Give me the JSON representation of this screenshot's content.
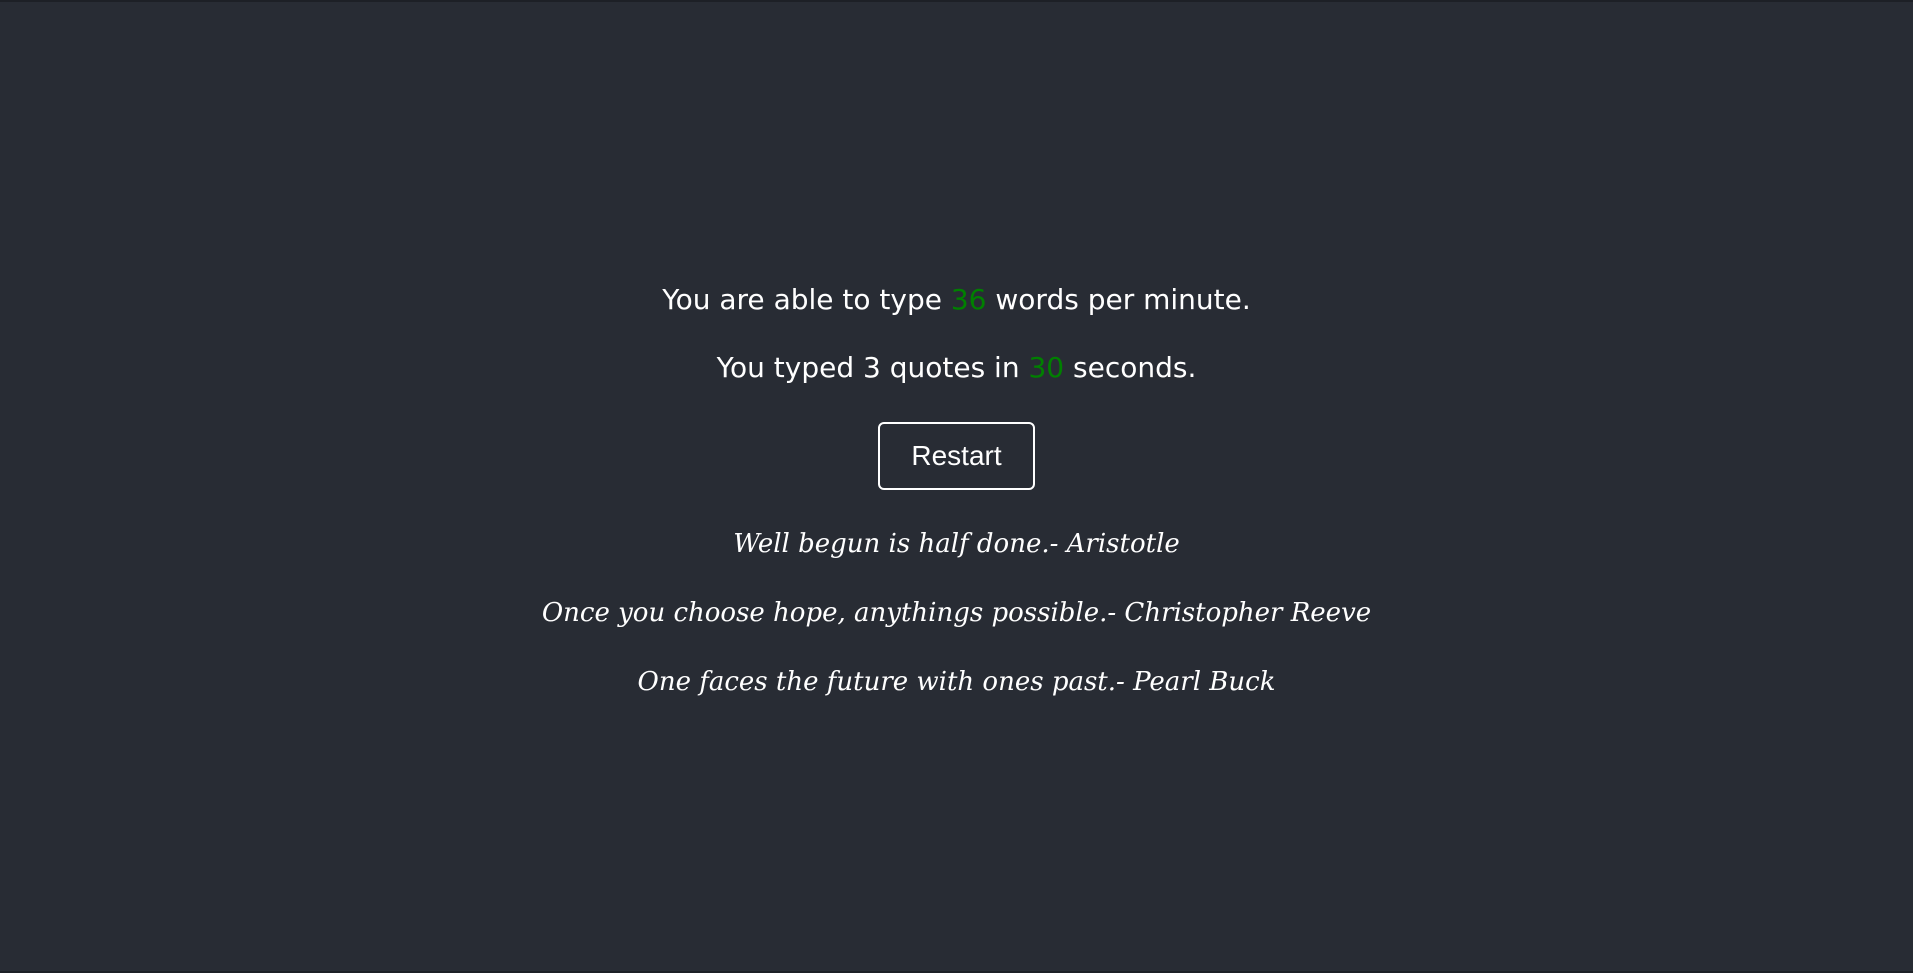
{
  "results": {
    "wpm_prefix": "You are able to type ",
    "wpm_value": "36",
    "wpm_suffix": " words per minute.",
    "quotes_prefix": "You typed 3 quotes in ",
    "seconds_value": "30",
    "quotes_suffix": " seconds."
  },
  "restart": {
    "label": "Restart"
  },
  "quotes": [
    {
      "text": "Well begun is half done.",
      "author": "- Aristotle"
    },
    {
      "text": "Once you choose hope, anythings possible.",
      "author": "- Christopher Reeve"
    },
    {
      "text": "One faces the future with ones past.",
      "author": "- Pearl Buck"
    }
  ],
  "colors": {
    "background": "#282c34",
    "text": "#ffffff",
    "highlight": "#008000"
  }
}
